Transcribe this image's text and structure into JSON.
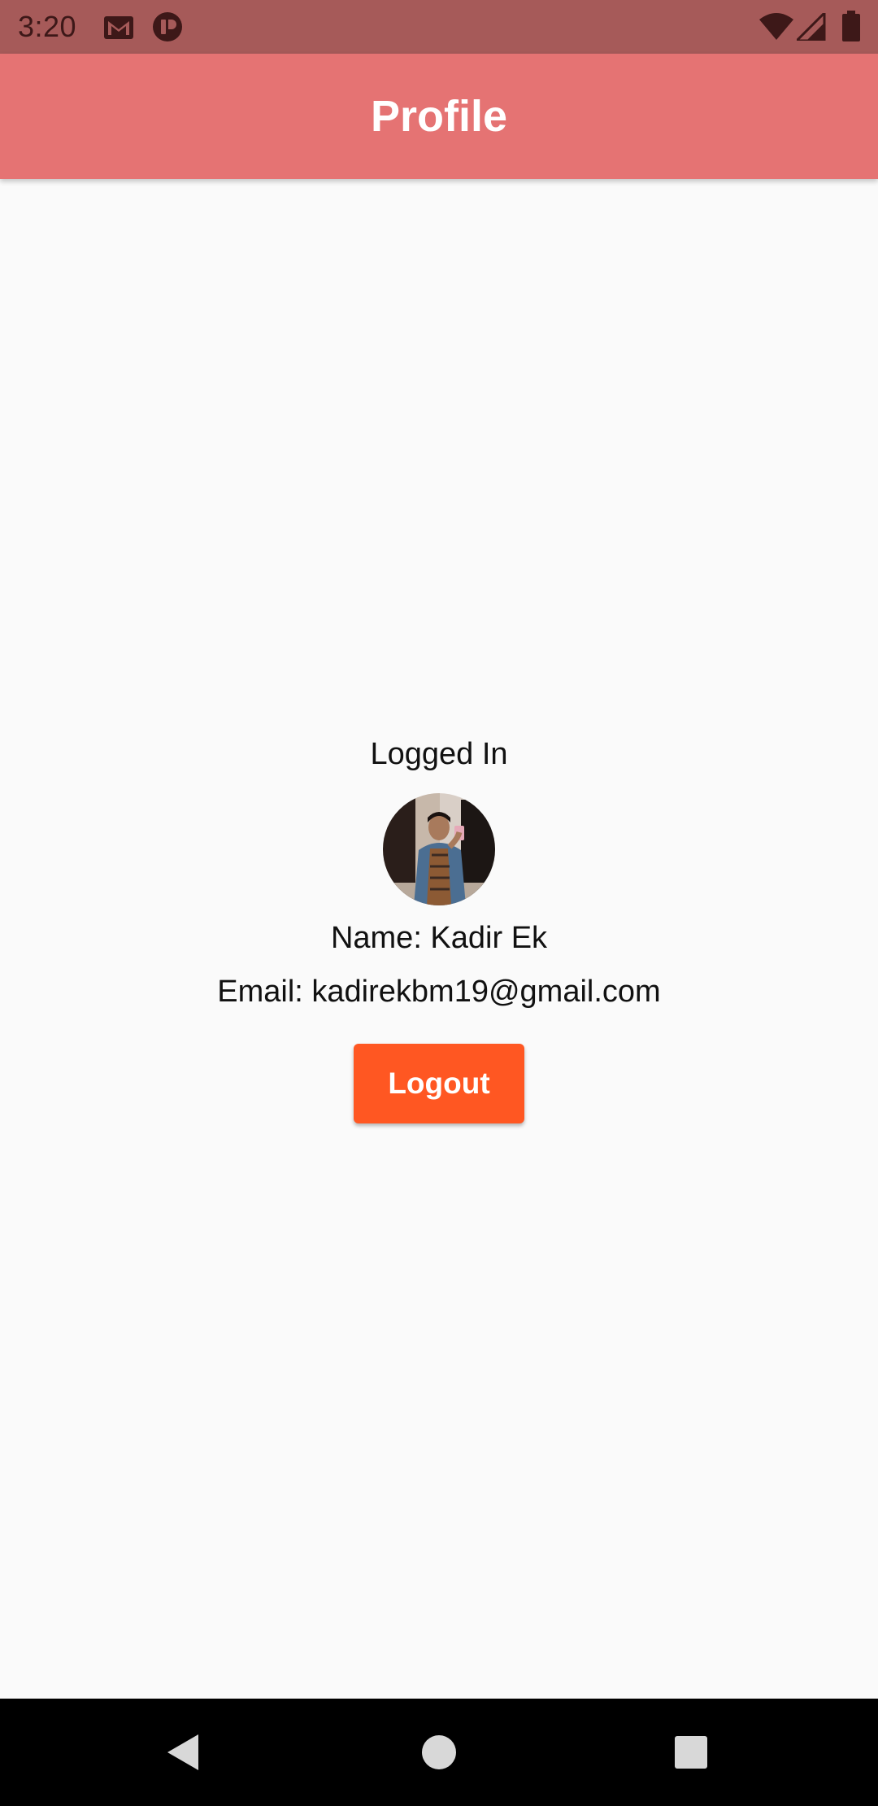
{
  "status_bar": {
    "time": "3:20",
    "left_icons": [
      "gmail-icon",
      "app-notification-icon"
    ],
    "right_icons": [
      "wifi-icon",
      "cell-signal-icon",
      "battery-icon"
    ],
    "background_color": "#a65a59"
  },
  "app_bar": {
    "title": "Profile",
    "background_color": "#e57373"
  },
  "profile": {
    "status": "Logged In",
    "name_line": "Name: Kadir Ek",
    "email_line": "Email: kadirekbm19@gmail.com",
    "avatar_icon": "profile-photo"
  },
  "actions": {
    "logout_label": "Logout",
    "logout_color": "#ff5722"
  },
  "nav_bar": {
    "buttons": [
      "back-icon",
      "home-icon",
      "recents-icon"
    ]
  }
}
